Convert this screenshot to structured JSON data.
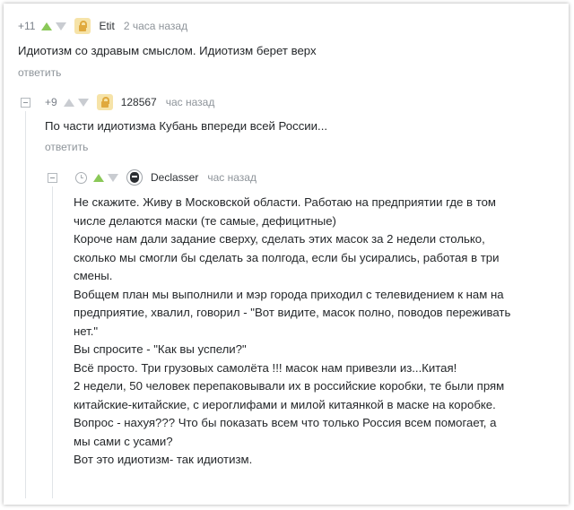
{
  "comments": [
    {
      "rating": "+11",
      "username": "Etit",
      "time": "2 часа назад",
      "lines": [
        "Идиотизм со здравым смыслом. Идиотизм берет верх"
      ],
      "reply_label": "ответить"
    },
    {
      "rating": "+9",
      "username": "128567",
      "time": "час назад",
      "lines": [
        "По части идиотизма Кубань впереди всей России..."
      ],
      "reply_label": "ответить"
    },
    {
      "username": "Declasser",
      "time": "час назад",
      "lines": [
        "Не скажите. Живу в Московской области. Работаю на предприятии где в том",
        "числе делаются маски (те самые, дефицитные)",
        "Короче нам дали задание сверху, сделать этих масок за 2 недели столько,",
        "сколько мы смогли бы сделать за полгода, если бы усирались, работая в три",
        "смены.",
        "Вобщем план мы выполнили и мэр города приходил с телевидением к нам на",
        "предприятие, хвалил, говорил - \"Вот видите, масок полно, поводов переживать",
        "нет.\"",
        "Вы спросите - \"Как вы успели?\"",
        "Всё просто. Три грузовых самолёта !!! масок нам привезли из...Китая!",
        "2 недели, 50 человек перепаковывали их в российские коробки, те были прям",
        "китайские-китайские, с иероглифами и милой китаянкой в маске на коробке.",
        "Вопрос - нахуя??? Что бы показать всем что только Россия всем помогает, а",
        "мы сами с усами?",
        "Вот это идиотизм- так идиотизм."
      ]
    }
  ]
}
